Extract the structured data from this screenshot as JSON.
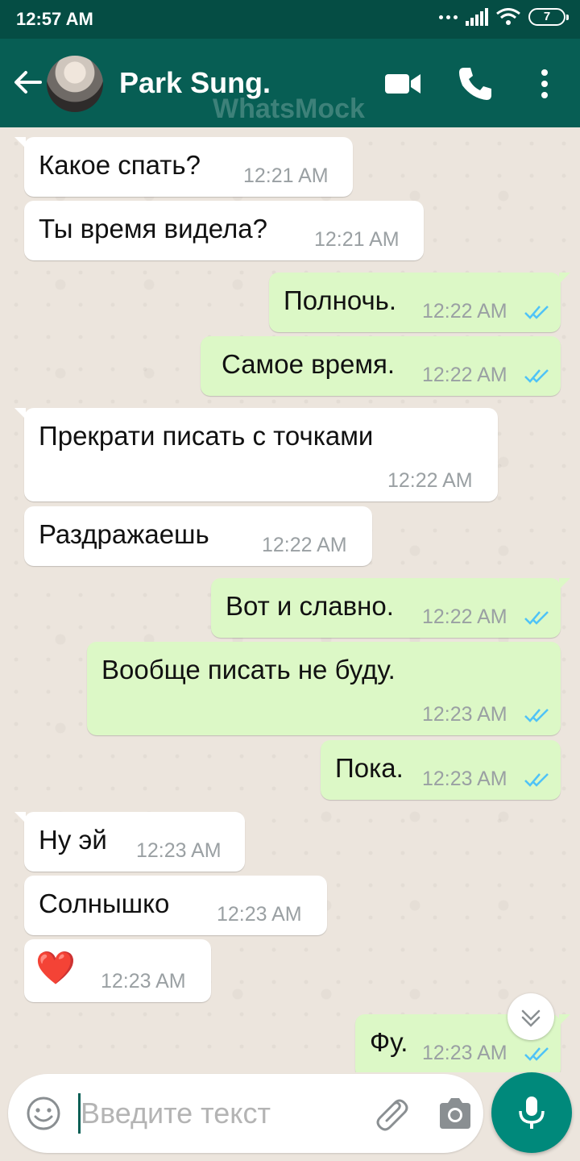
{
  "status": {
    "time": "12:57 AM",
    "battery": "7"
  },
  "header": {
    "contact_name": "Park Sung.",
    "watermark": "WhatsMock"
  },
  "messages": [
    {
      "direction": "in",
      "text": "Какое спать?",
      "time": "12:21 AM"
    },
    {
      "direction": "in",
      "text": "Ты время видела?",
      "time": "12:21 AM"
    },
    {
      "direction": "out",
      "text": "Полночь.",
      "time": "12:22 AM",
      "read": true
    },
    {
      "direction": "out",
      "text": "Самое время.",
      "time": "12:22 AM",
      "read": true
    },
    {
      "direction": "in",
      "text": "Прекрати писать с точками",
      "time": "12:22 AM"
    },
    {
      "direction": "in",
      "text": "Раздражаешь",
      "time": "12:22 AM"
    },
    {
      "direction": "out",
      "text": "Вот и славно.",
      "time": "12:22 AM",
      "read": true
    },
    {
      "direction": "out",
      "text": "Вообще писать не буду.",
      "time": "12:23 AM",
      "read": true
    },
    {
      "direction": "out",
      "text": "Пока.",
      "time": "12:23 AM",
      "read": true
    },
    {
      "direction": "in",
      "text": "Ну эй",
      "time": "12:23 AM"
    },
    {
      "direction": "in",
      "text": "Солнышко",
      "time": "12:23 AM"
    },
    {
      "direction": "in",
      "text": "❤️",
      "time": "12:23 AM"
    },
    {
      "direction": "out",
      "text": "Фу.",
      "time": "12:23 AM",
      "read": true
    }
  ],
  "composer": {
    "placeholder": "Введите текст"
  },
  "colors": {
    "header": "#075e54",
    "status_bar": "#054d44",
    "outgoing": "#dcf8c6",
    "incoming": "#ffffff",
    "read_ticks": "#4fc3f7",
    "mic_button": "#00897b"
  },
  "icons": [
    "back-arrow-icon",
    "video-call-icon",
    "phone-icon",
    "more-vert-icon",
    "emoji-icon",
    "attach-icon",
    "camera-icon",
    "mic-icon",
    "chevron-down-icon",
    "double-check-icon"
  ]
}
